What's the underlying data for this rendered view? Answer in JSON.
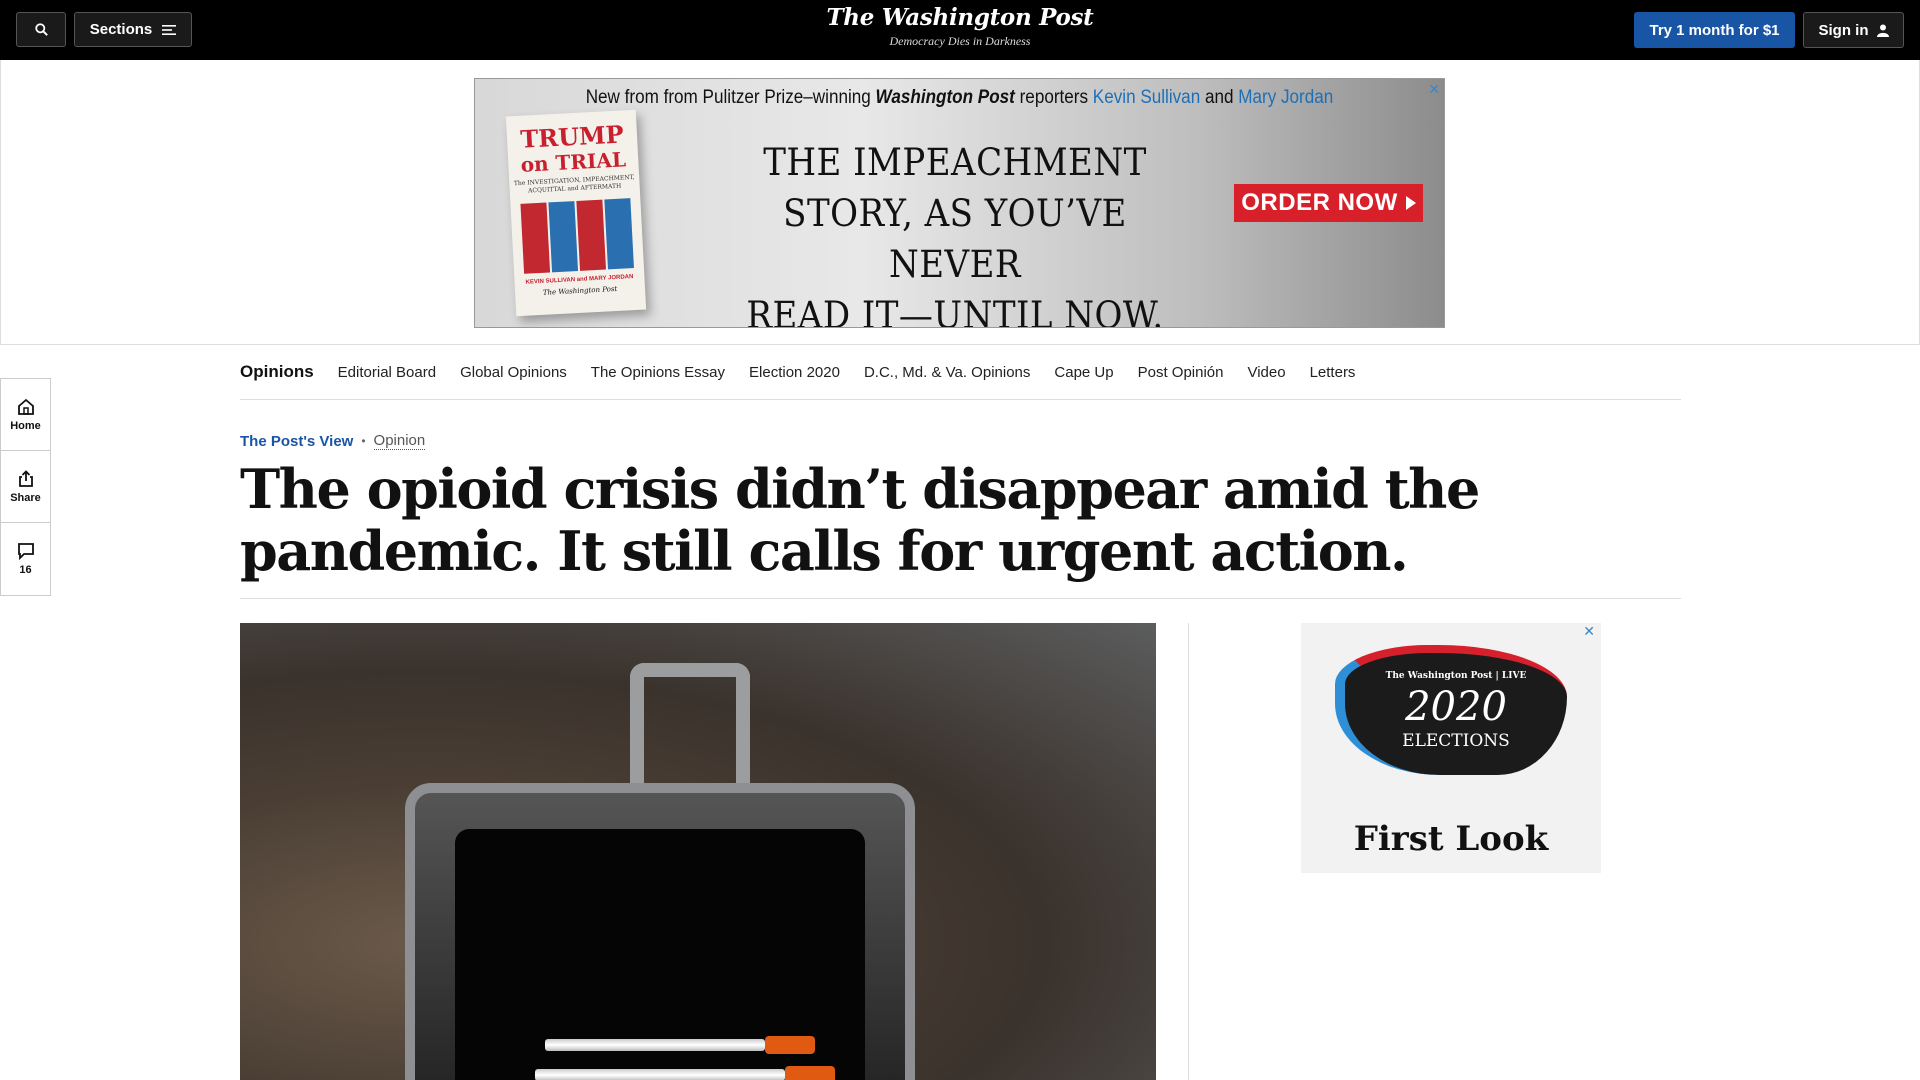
{
  "header": {
    "sections_label": "Sections",
    "logo_text": "The Washington Post",
    "tagline": "Democracy Dies in Darkness",
    "try_label": "Try 1 month for $1",
    "signin_label": "Sign in"
  },
  "banner_ad": {
    "promo_pre": "New from from Pulitzer Prize–winning ",
    "promo_wp": "Washington Post",
    "promo_mid": " reporters ",
    "promo_name1": "Kevin Sullivan",
    "promo_and": " and ",
    "promo_name2": "Mary Jordan",
    "book_title_1": "TRUMP",
    "book_title_2": "on TRIAL",
    "book_sub": "The INVESTIGATION, IMPEACHMENT, ACQUITTAL and AFTERMATH",
    "book_authors": "KEVIN SULLIVAN and MARY JORDAN",
    "book_publisher": "The Washington Post",
    "headline_1": "THE IMPEACHMENT",
    "headline_2": "STORY, AS YOU’VE NEVER",
    "headline_3": "READ IT—UNTIL NOW.",
    "cta": "ORDER NOW",
    "close": "✕"
  },
  "rail": {
    "home": "Home",
    "share": "Share",
    "comments_count": "16"
  },
  "subnav": {
    "main": "Opinions",
    "items": [
      "Editorial Board",
      "Global Opinions",
      "The Opinions Essay",
      "Election 2020",
      "D.C., Md. & Va. Opinions",
      "Cape Up",
      "Post Opinión",
      "Video",
      "Letters"
    ]
  },
  "article": {
    "kicker": "The Post's View",
    "kicker_sep": "•",
    "label": "Opinion",
    "headline": "The opioid crisis didn’t disappear amid the pandemic. It still calls for urgent action."
  },
  "side_ad": {
    "brand": "The Washington Post | LIVE",
    "year": "2020",
    "elections": "ELECTIONS",
    "title": "First Look",
    "close": "✕"
  },
  "colors": {
    "accent_blue": "#1955a5",
    "ad_red": "#d8202b",
    "header_bg": "#000000"
  }
}
